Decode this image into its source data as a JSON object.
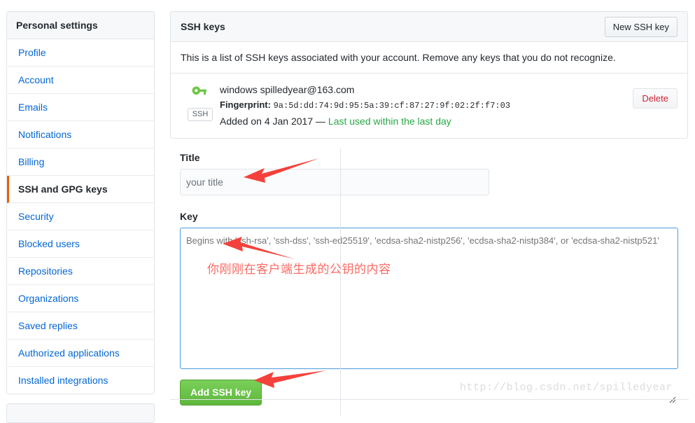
{
  "sidebar": {
    "header": "Personal settings",
    "items": [
      {
        "label": "Profile",
        "active": false
      },
      {
        "label": "Account",
        "active": false
      },
      {
        "label": "Emails",
        "active": false
      },
      {
        "label": "Notifications",
        "active": false
      },
      {
        "label": "Billing",
        "active": false
      },
      {
        "label": "SSH and GPG keys",
        "active": true
      },
      {
        "label": "Security",
        "active": false
      },
      {
        "label": "Blocked users",
        "active": false
      },
      {
        "label": "Repositories",
        "active": false
      },
      {
        "label": "Organizations",
        "active": false
      },
      {
        "label": "Saved replies",
        "active": false
      },
      {
        "label": "Authorized applications",
        "active": false
      },
      {
        "label": "Installed integrations",
        "active": false
      }
    ],
    "active_accent_color": "#e36209"
  },
  "main": {
    "panel_title": "SSH keys",
    "new_key_button": "New SSH key",
    "description": "This is a list of SSH keys associated with your account. Remove any keys that you do not recognize.",
    "keys": [
      {
        "badge": "SSH",
        "title": "windows spilledyear@163.com",
        "fingerprint_label": "Fingerprint:",
        "fingerprint": "9a:5d:dd:74:9d:95:5a:39:cf:87:27:9f:02:2f:f7:03",
        "added": "Added on 4 Jan 2017 — ",
        "last_used": "Last used within the last day",
        "delete_button": "Delete",
        "icon_color": "#6cc644",
        "last_used_color": "#28a745",
        "delete_color": "#cb2431"
      }
    ],
    "form": {
      "title_label": "Title",
      "title_value": "your title",
      "title_placeholder": "your title",
      "key_label": "Key",
      "key_value": "",
      "key_placeholder": "Begins with 'ssh-rsa', 'ssh-dss', 'ssh-ed25519', 'ecdsa-sha2-nistp256', 'ecdsa-sha2-nistp384', or 'ecdsa-sha2-nistp521'",
      "submit_button": "Add SSH key",
      "submit_color": "#6cc644",
      "textarea_focus_color": "#4a9ae0"
    }
  },
  "annotations": {
    "chinese_note": "你刚刚在客户端生成的公钥的内容",
    "arrow_color": "#f5413b",
    "note_color": "#fb6a63",
    "watermark": "http://blog.csdn.net/spilledyear"
  }
}
